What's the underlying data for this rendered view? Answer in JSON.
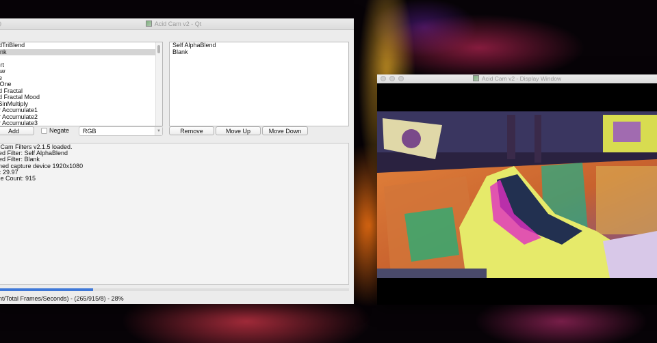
{
  "main_window": {
    "title": "Acid Cam v2 - Qt",
    "filter_list": [
      "ndTriBlend",
      "lank",
      "",
      "tort",
      "raw",
      "be",
      "wOne",
      "nd Fractal",
      "nd Fractal Mood",
      "sSinMultiply",
      "or Accumulate1",
      "or Accumulate2",
      "or Accumulate3"
    ],
    "selected_filter_index": 1,
    "applied_filters": [
      "Self AlphaBlend",
      "Blank"
    ],
    "add_label": "Add",
    "negate_label": "Negate",
    "negate_checked": false,
    "color_mode": "RGB",
    "remove_label": "Remove",
    "move_up_label": "Move Up",
    "move_down_label": "Move Down",
    "log_lines": [
      "d Cam Filters v2.1.5 loaded.",
      "ded Filter: Self AlphaBlend",
      "ded Filter: Blank",
      "ened capture device 1920x1080",
      "S: 29.97",
      "me Count: 915"
    ],
    "progress_fraction": 0.28,
    "status_text": "rent/Total Frames/Seconds) - (265/915/8)  - 28%"
  },
  "display_window": {
    "title": "Acid Cam v2 - Display Window"
  },
  "colors": {
    "window_bg": "#ececec",
    "progress": "#3f78d8",
    "selection": "#d4d4d4"
  }
}
